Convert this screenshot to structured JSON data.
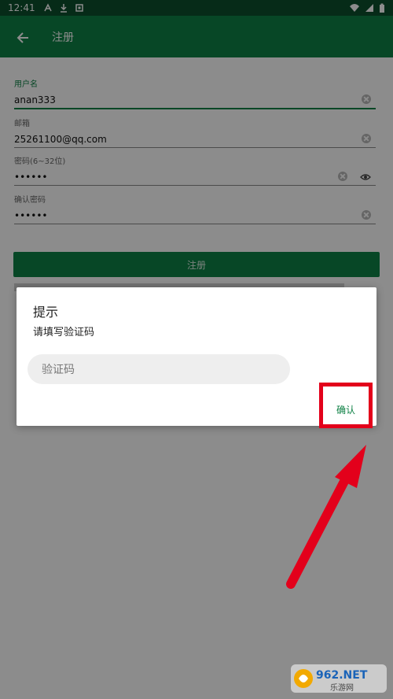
{
  "status_bar": {
    "time": "12:41",
    "icons": [
      "app-icon-a",
      "download-icon",
      "app-icon-square"
    ],
    "right_icons": [
      "wifi-icon",
      "signal-icon",
      "battery-icon"
    ]
  },
  "app_bar": {
    "back_icon": "arrow-left-icon",
    "title": "注册"
  },
  "form": {
    "username": {
      "label": "用户名",
      "value": "anan333"
    },
    "email": {
      "label": "邮箱",
      "value": "25261100@qq.com"
    },
    "password": {
      "label": "密码(6~32位)",
      "value": "••••••"
    },
    "confirm_password": {
      "label": "确认密码",
      "value": "••••••"
    },
    "register_label": "注册"
  },
  "dialog": {
    "title": "提示",
    "message": "请填写验证码",
    "input_placeholder": "验证码",
    "confirm_label": "确认"
  },
  "annotation": {
    "highlight_color": "#e3001b"
  },
  "watermark": {
    "text_top": "962.NET",
    "text_bottom": "乐游网"
  },
  "colors": {
    "primary": "#0e8145",
    "primary_dark": "#0b4f2c"
  }
}
